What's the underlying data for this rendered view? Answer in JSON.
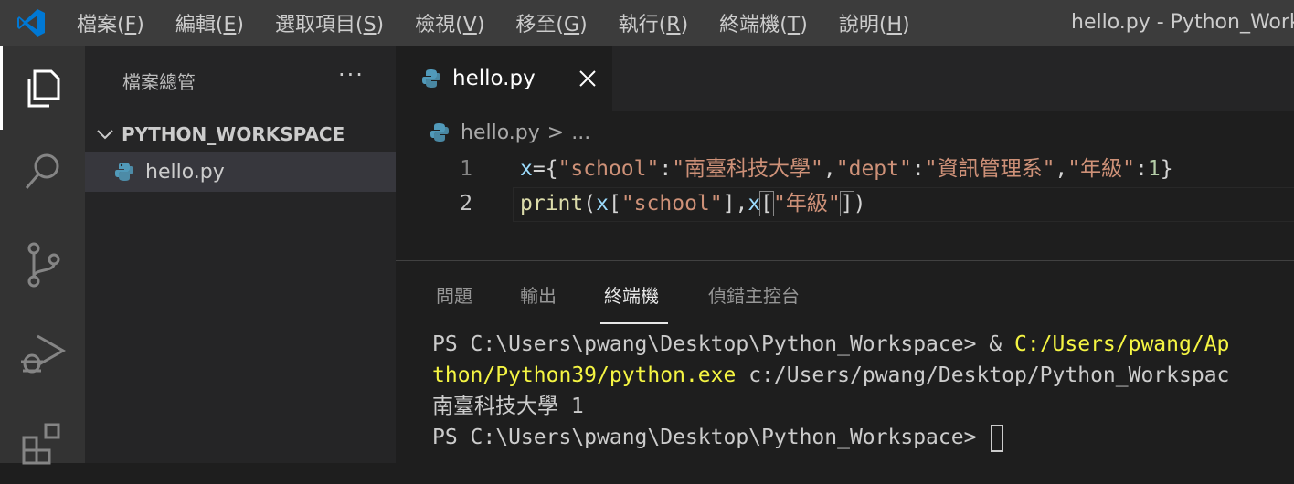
{
  "menu": {
    "items": [
      {
        "label": "檔案",
        "key": "F"
      },
      {
        "label": "編輯",
        "key": "E"
      },
      {
        "label": "選取項目",
        "key": "S"
      },
      {
        "label": "檢視",
        "key": "V"
      },
      {
        "label": "移至",
        "key": "G"
      },
      {
        "label": "執行",
        "key": "R"
      },
      {
        "label": "終端機",
        "key": "T"
      },
      {
        "label": "說明",
        "key": "H"
      }
    ],
    "window_title": "hello.py - Python_Work"
  },
  "activity": {
    "icons": [
      "explorer-icon",
      "search-icon",
      "source-control-icon",
      "run-debug-icon",
      "extensions-icon"
    ]
  },
  "sidebar": {
    "title": "檔案總管",
    "more": "···",
    "folder": "PYTHON_WORKSPACE",
    "file": "hello.py"
  },
  "editor": {
    "tab_label": "hello.py",
    "breadcrumb_file": "hello.py",
    "breadcrumb_sep": ">",
    "breadcrumb_more": "...",
    "lines": [
      {
        "number": "1"
      },
      {
        "number": "2"
      }
    ],
    "code": {
      "l1": {
        "var": "x",
        "eq_brace": "={",
        "k1": "\"school\"",
        "c1": ":",
        "v1": "\"南臺科技大學\"",
        "comma1": ",",
        "k2": "\"dept\"",
        "c2": ":",
        "v2": "\"資訊管理系\"",
        "comma2": ",",
        "k3": "\"年級\"",
        "c3": ":",
        "v3": "1",
        "close": "}"
      },
      "l2": {
        "fn": "print",
        "paren_open": "(",
        "x1": "x",
        "b1": "[",
        "s1": "\"school\"",
        "b2": "],",
        "x2": "x",
        "b3": "[",
        "s2": "\"年級\"",
        "b4": "]",
        "paren_close": ")"
      }
    }
  },
  "panel": {
    "tabs": [
      "問題",
      "輸出",
      "終端機",
      "偵錯主控台"
    ],
    "active_tab": "終端機",
    "terminal": {
      "line1_prompt": "PS C:\\Users\\pwang\\Desktop\\Python_Workspace> & ",
      "line1_path": "C:/Users/pwang/Ap",
      "line2_path": "thon/Python39/python.exe",
      "line2_rest": " c:/Users/pwang/Desktop/Python_Workspac",
      "line3": "南臺科技大學 1",
      "line4_prompt": "PS C:\\Users\\pwang\\Desktop\\Python_Workspace> "
    }
  },
  "colors": {
    "accent_vscode": "#0078d4",
    "python_blue": "#519aba",
    "string": "#ce9178",
    "variable": "#9cdcfe",
    "function": "#dcdcaa",
    "number": "#b5cea8",
    "terminal_yellow": "#f5f543"
  }
}
